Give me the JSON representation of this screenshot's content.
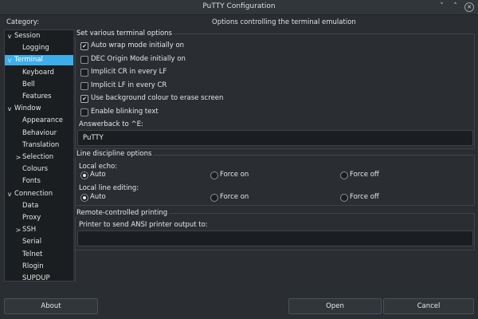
{
  "window": {
    "title": "PuTTY Configuration"
  },
  "category_label": "Category:",
  "panel_header": "Options controlling the terminal emulation",
  "tree": [
    {
      "label": "Session",
      "arrow": "v"
    },
    {
      "label": "Logging"
    },
    {
      "label": "Terminal",
      "arrow": "v",
      "selected": true
    },
    {
      "label": "Keyboard"
    },
    {
      "label": "Bell"
    },
    {
      "label": "Features"
    },
    {
      "label": "Window",
      "arrow": "v"
    },
    {
      "label": "Appearance"
    },
    {
      "label": "Behaviour"
    },
    {
      "label": "Translation"
    },
    {
      "label": "Selection",
      "arrow": ">"
    },
    {
      "label": "Colours"
    },
    {
      "label": "Fonts"
    },
    {
      "label": "Connection",
      "arrow": "v"
    },
    {
      "label": "Data"
    },
    {
      "label": "Proxy"
    },
    {
      "label": "SSH",
      "arrow": ">"
    },
    {
      "label": "Serial"
    },
    {
      "label": "Telnet"
    },
    {
      "label": "Rlogin"
    },
    {
      "label": "SUPDUP"
    }
  ],
  "terminal_options": {
    "title": "Set various terminal options",
    "items": [
      {
        "label": "Auto wrap mode initially on",
        "checked": true
      },
      {
        "label": "DEC Origin Mode initially on",
        "checked": false
      },
      {
        "label": "Implicit CR in every LF",
        "checked": false
      },
      {
        "label": "Implicit LF in every CR",
        "checked": false
      },
      {
        "label": "Use background colour to erase screen",
        "checked": true
      },
      {
        "label": "Enable blinking text",
        "checked": false
      }
    ],
    "answerback_label": "Answerback to ^E:",
    "answerback_value": "PuTTY"
  },
  "line_discipline": {
    "title": "Line discipline options",
    "local_echo_label": "Local echo:",
    "local_editing_label": "Local line editing:",
    "options": [
      "Auto",
      "Force on",
      "Force off"
    ],
    "echo_selected": "Auto",
    "editing_selected": "Auto"
  },
  "printing": {
    "title": "Remote-controlled printing",
    "printer_label": "Printer to send ANSI printer output to:",
    "printer_value": ""
  },
  "buttons": {
    "about": "About",
    "open": "Open",
    "cancel": "Cancel"
  },
  "icons": {
    "check": "✔",
    "close": "✕",
    "min": "˅",
    "max": "˄"
  }
}
